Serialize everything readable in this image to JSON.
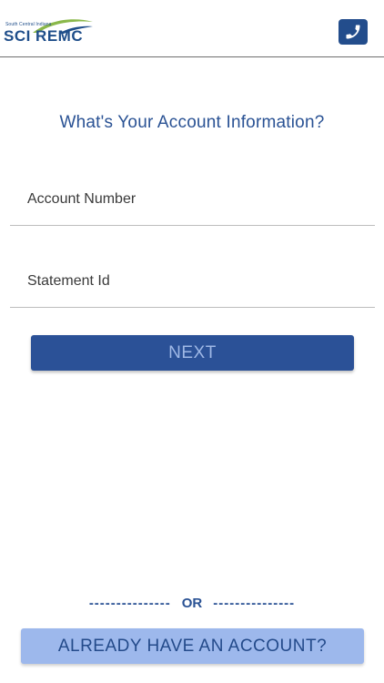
{
  "header": {
    "logo_small": "South Central Indiana",
    "logo_main": "SCI REMC",
    "phone_icon": "phone-icon"
  },
  "form": {
    "title": "What's Your Account Information?",
    "account_number_placeholder": "Account Number",
    "statement_id_placeholder": "Statement Id",
    "next_label": "NEXT"
  },
  "footer": {
    "or_left_dashes": "---------------",
    "or_label": "OR",
    "or_right_dashes": "---------------",
    "already_account_label": "ALREADY HAVE AN ACCOUNT?"
  },
  "colors": {
    "brand_blue": "#2b5197",
    "light_blue": "#9db8ec",
    "logo_green": "#8ab84a"
  }
}
